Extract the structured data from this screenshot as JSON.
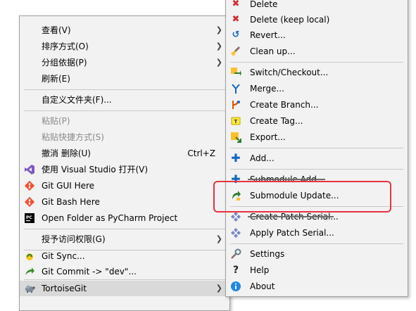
{
  "left_menu": {
    "items": [
      {
        "label": "查看(V)",
        "arrow": true
      },
      {
        "label": "排序方式(O)",
        "arrow": true
      },
      {
        "label": "分组依据(P)",
        "arrow": true
      },
      {
        "label": "刷新(E)"
      },
      {
        "label": "自定义文件夹(F)..."
      },
      {
        "label": "粘贴(P)",
        "disabled": true
      },
      {
        "label": "粘贴快捷方式(S)",
        "disabled": true
      },
      {
        "label": "撤消 删除(U)",
        "shortcut": "Ctrl+Z"
      },
      {
        "label": "使用 Visual Studio 打开(V)",
        "icon": "visual-studio-icon"
      },
      {
        "label": "Git GUI Here",
        "icon": "git-icon"
      },
      {
        "label": "Git Bash Here",
        "icon": "git-icon"
      },
      {
        "label": "Open Folder as PyCharm Project",
        "icon": "pycharm-icon"
      },
      {
        "label": "授予访问权限(G)",
        "arrow": true
      },
      {
        "label": "Git Sync...",
        "icon": "git-sync-icon"
      },
      {
        "label": "Git Commit -> \"dev\"...",
        "icon": "git-commit-icon"
      },
      {
        "label": "TortoiseGit",
        "icon": "tortoisegit-icon",
        "arrow": true,
        "highlighted": true
      }
    ]
  },
  "right_menu": {
    "items": [
      {
        "label": "Delete",
        "icon": "delete-icon"
      },
      {
        "label": "Delete (keep local)",
        "icon": "delete-icon"
      },
      {
        "label": "Revert...",
        "icon": "revert-icon"
      },
      {
        "label": "Clean up...",
        "icon": "cleanup-icon"
      },
      {
        "label": "Switch/Checkout...",
        "icon": "switch-icon"
      },
      {
        "label": "Merge...",
        "icon": "merge-icon"
      },
      {
        "label": "Create Branch...",
        "icon": "branch-icon"
      },
      {
        "label": "Create Tag...",
        "icon": "tag-icon"
      },
      {
        "label": "Export...",
        "icon": "export-icon"
      },
      {
        "label": "Add...",
        "icon": "add-icon"
      },
      {
        "label": "Submodule Add...",
        "icon": "add-icon",
        "struck": true
      },
      {
        "label": "Submodule Update...",
        "icon": "submodule-update-icon"
      },
      {
        "label": "Create Patch Serial...",
        "icon": "patch-icon",
        "struck": true
      },
      {
        "label": "Apply Patch Serial...",
        "icon": "patch-icon"
      },
      {
        "label": "Settings",
        "icon": "settings-icon"
      },
      {
        "label": "Help",
        "icon": "help-icon"
      },
      {
        "label": "About",
        "icon": "about-icon"
      }
    ]
  },
  "colors": {
    "menu_bg": "#f2f2f2",
    "highlight_bg": "#d9d9d9",
    "annotation_red": "#e8323f",
    "disabled_text": "#8a8a8a"
  }
}
